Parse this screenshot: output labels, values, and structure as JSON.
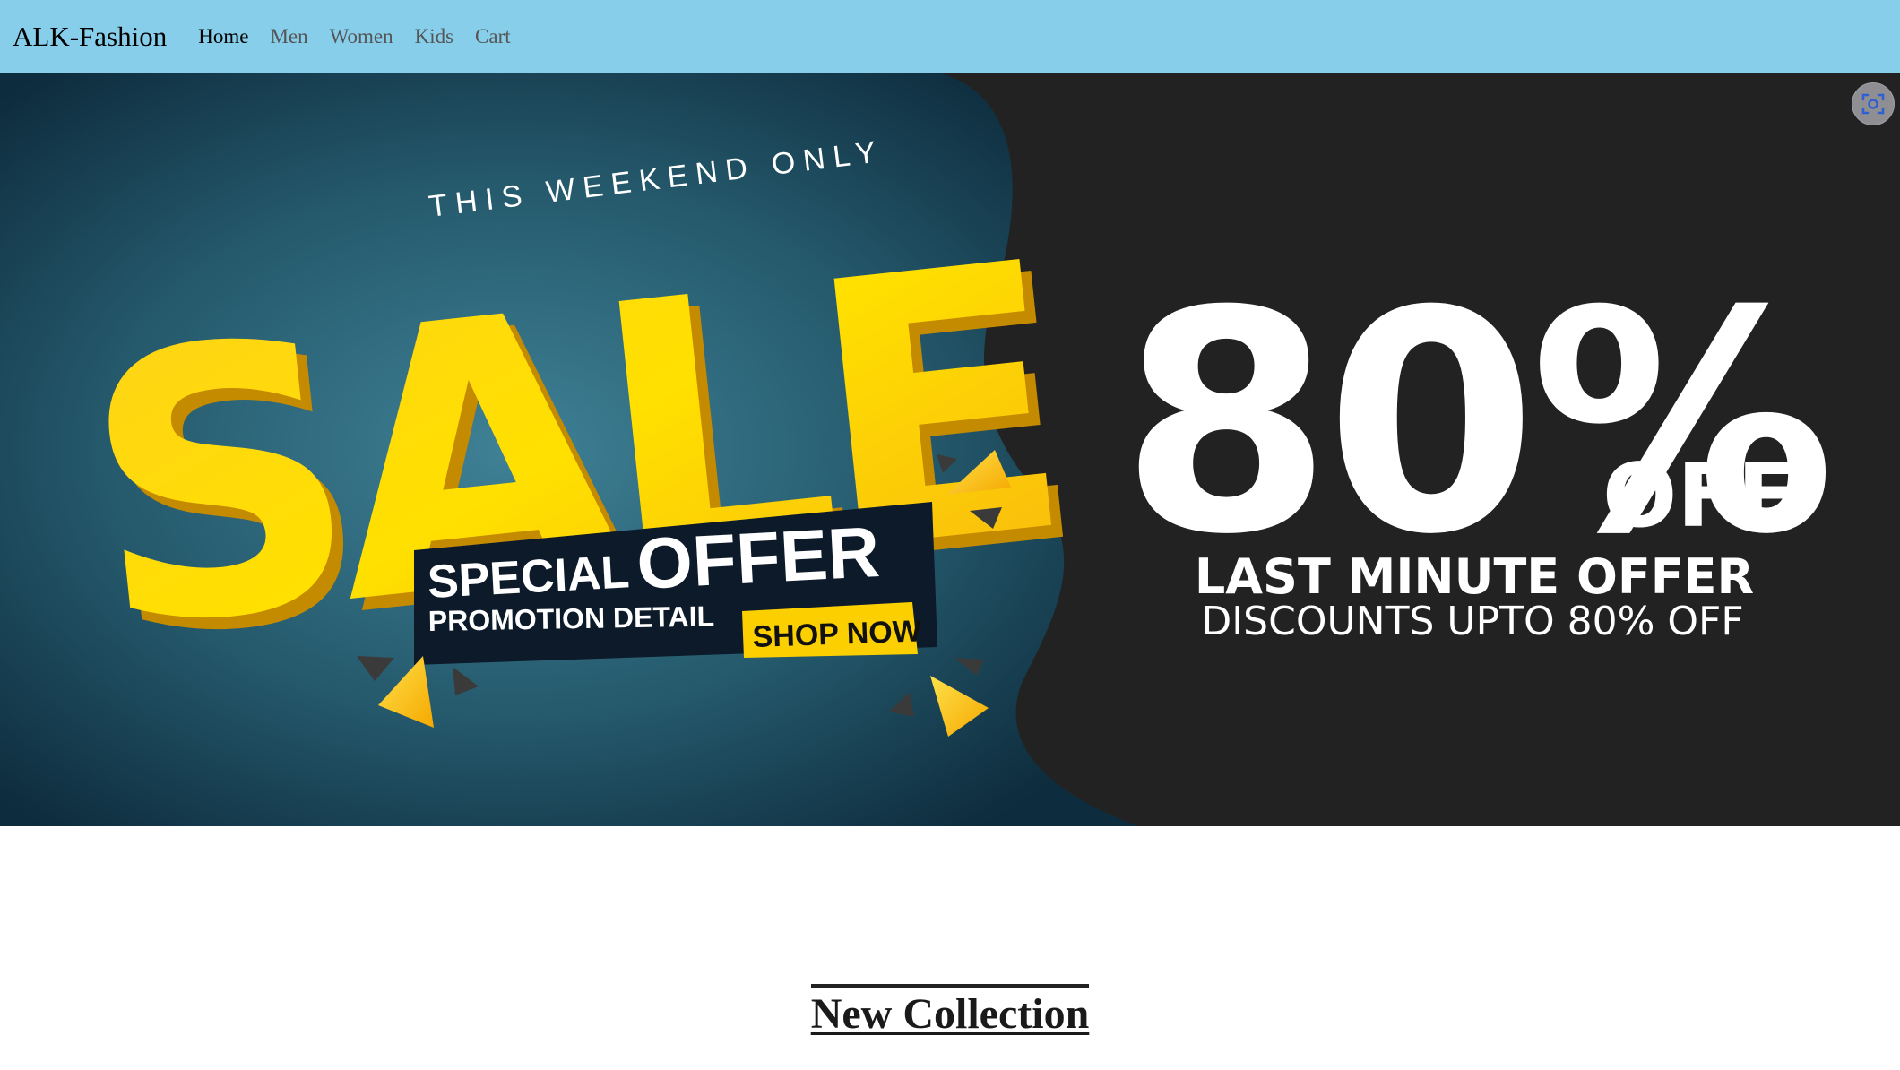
{
  "navbar": {
    "brand": "ALK-Fashion",
    "links": [
      {
        "label": "Home",
        "active": true
      },
      {
        "label": "Men",
        "active": false
      },
      {
        "label": "Women",
        "active": false
      },
      {
        "label": "Kids",
        "active": false
      },
      {
        "label": "Cart",
        "active": false
      }
    ],
    "background": "#87ceeb"
  },
  "banner": {
    "tagline": "THIS WEEKEND ONLY",
    "headline": "SALE",
    "special_word": "SPECIAL",
    "offer_word": "OFFER",
    "promotion": "PROMOTION DETAIL",
    "cta": "SHOP NOW",
    "discount": "80%",
    "off": "OFF",
    "last_minute": "LAST MINUTE OFFER",
    "discounts_line": "DISCOUNTS UPTO 80% OFF",
    "colors": {
      "teal": "#2e6a7e",
      "dark": "#222223",
      "yellow": "#fcd000"
    }
  },
  "screen_capture_icon": "screen-capture-icon",
  "section": {
    "title": "New Collection"
  }
}
